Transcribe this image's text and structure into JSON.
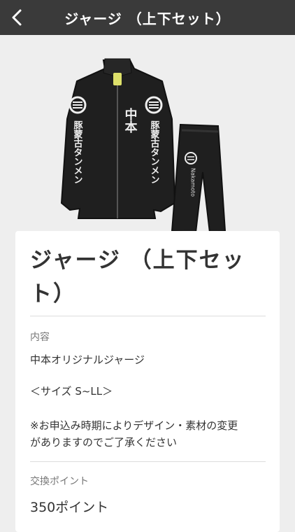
{
  "header": {
    "title": "ジャージ （上下セット）",
    "back_icon": "chevron-left-icon"
  },
  "product_image": {
    "jacket_sleeve_text": "豚蒙古タンメン",
    "jacket_chest_text": "中本",
    "pants_text": "Nakamoto"
  },
  "item": {
    "title_line1": "ジャージ （上下セッ",
    "title_line2": "ト）",
    "content_label": "内容",
    "content_name": "中本オリジナルジャージ",
    "size_text": "＜サイズ S~LL＞",
    "note_line1": "※お申込み時期によりデザイン・素材の変更",
    "note_line2": "がありますのでご了承ください",
    "points_label": "交換ポイント",
    "points_value": "350ポイント"
  },
  "colors": {
    "header_bg": "#3a3a3a",
    "page_bg": "#eeeeee",
    "card_bg": "#ffffff",
    "text_main": "#333333",
    "text_label": "#777777"
  }
}
